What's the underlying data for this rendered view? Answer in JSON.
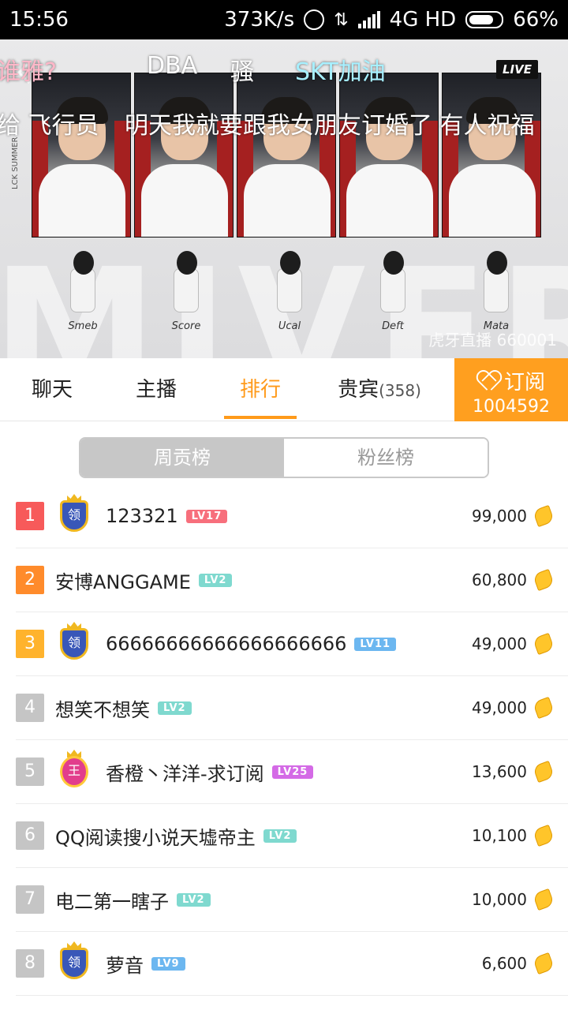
{
  "status_bar": {
    "time": "15:56",
    "speed": "373K/s",
    "network": "4G HD",
    "battery": "66%"
  },
  "video": {
    "live_badge": "LIVE",
    "background_text": "MIVER",
    "vertical_label": "LCK SUMMER",
    "danmaku": [
      {
        "text": "谁雅?",
        "color": "pink"
      },
      {
        "text": "DBA",
        "color": "white"
      },
      {
        "text": "骚",
        "color": "white"
      },
      {
        "text": "SKT加油",
        "color": "cyan"
      },
      {
        "text": "给 飞行员",
        "color": "white"
      },
      {
        "text": "明天我就要跟我女朋友订婚了 有人祝福",
        "color": "white"
      }
    ],
    "players": [
      "Smeb",
      "Score",
      "Ucal",
      "Deft",
      "Mata"
    ],
    "watermark": "虎牙直播 660001"
  },
  "tabs": [
    {
      "label": "聊天",
      "active": false
    },
    {
      "label": "主播",
      "active": false
    },
    {
      "label": "排行",
      "active": true
    },
    {
      "label": "贵宾",
      "count": "(358)",
      "active": false
    }
  ],
  "subscribe": {
    "label": "订阅",
    "count": "1004592"
  },
  "segment": {
    "weekly": "周贡榜",
    "fans": "粉丝榜"
  },
  "ranking": [
    {
      "rank": "1",
      "name": "123321",
      "level": "LV17",
      "level_color": "red",
      "value": "99,000",
      "medal": "领"
    },
    {
      "rank": "2",
      "name": "安博ANGGAME",
      "level": "LV2",
      "level_color": "teal",
      "value": "60,800",
      "medal": ""
    },
    {
      "rank": "3",
      "name": "66666666666666666666",
      "level": "LV11",
      "level_color": "blue",
      "value": "49,000",
      "medal": "领"
    },
    {
      "rank": "4",
      "name": "想笑不想笑",
      "level": "LV2",
      "level_color": "teal",
      "value": "49,000",
      "medal": ""
    },
    {
      "rank": "5",
      "name": "香橙丶洋洋-求订阅",
      "level": "LV25",
      "level_color": "purple",
      "value": "13,600",
      "medal": "王"
    },
    {
      "rank": "6",
      "name": "QQ阅读搜小说天墟帝主",
      "level": "LV2",
      "level_color": "teal",
      "value": "10,100",
      "medal": ""
    },
    {
      "rank": "7",
      "name": "电二第一瞎子",
      "level": "LV2",
      "level_color": "teal",
      "value": "10,000",
      "medal": ""
    },
    {
      "rank": "8",
      "name": "萝音",
      "level": "LV9",
      "level_color": "blue",
      "value": "6,600",
      "medal": "领"
    }
  ]
}
